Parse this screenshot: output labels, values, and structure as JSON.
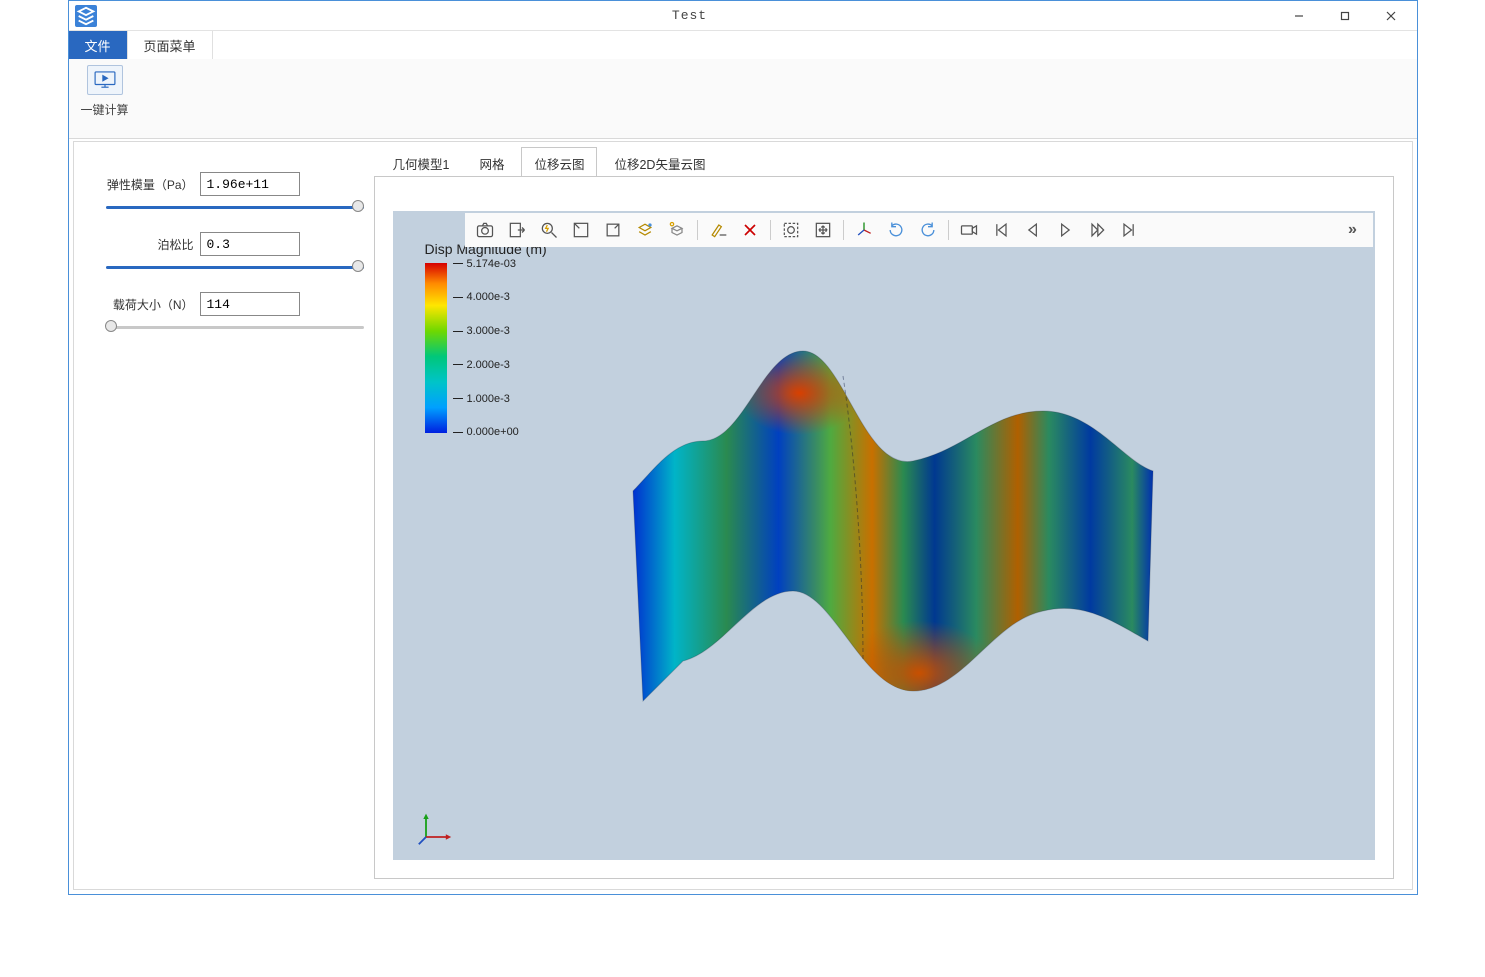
{
  "window": {
    "title": "Test",
    "minimize": "–",
    "maximize": "☐",
    "close": "✕"
  },
  "menubar": {
    "tabs": [
      {
        "label": "文件",
        "active": true
      },
      {
        "label": "页面菜单",
        "active": false
      }
    ]
  },
  "ribbon": {
    "compute": {
      "label": "一键计算"
    }
  },
  "params": {
    "elastic_modulus": {
      "label": "弹性模量（Pa）",
      "value": "1.96e+11",
      "slider_pos": 0.98
    },
    "poisson_ratio": {
      "label": "泊松比",
      "value": "0.3",
      "slider_pos": 0.98
    },
    "load": {
      "label": "载荷大小（N）",
      "value": "114",
      "slider_pos": 0.02
    }
  },
  "viz_tabs": [
    {
      "label": "几何模型1",
      "active": false
    },
    {
      "label": "网格",
      "active": false
    },
    {
      "label": "位移云图",
      "active": true
    },
    {
      "label": "位移2D矢量云图",
      "active": false
    }
  ],
  "toolbar": {
    "more": "»"
  },
  "legend": {
    "title": "Disp Magnitude (m)",
    "ticks": [
      "5.174e-03",
      "4.000e-3",
      "3.000e-3",
      "2.000e-3",
      "1.000e-3",
      "0.000e+00"
    ]
  },
  "chart_data": {
    "type": "heatmap",
    "title": "Disp Magnitude (m)",
    "colorbar_range": [
      0.0,
      0.005174
    ],
    "colorbar_ticks": [
      0.0,
      0.001,
      0.002,
      0.003,
      0.004,
      0.005174
    ],
    "description": "Displacement magnitude contour plot on a deformed wavy surface mesh; hot colors (red/orange ≈ 5e-3 m) at two peaks and interior lobes, cool colors (blue ≈ 0 m) along vertical bands and left edge.",
    "triad_axes": [
      "X",
      "Y",
      "Z"
    ]
  }
}
